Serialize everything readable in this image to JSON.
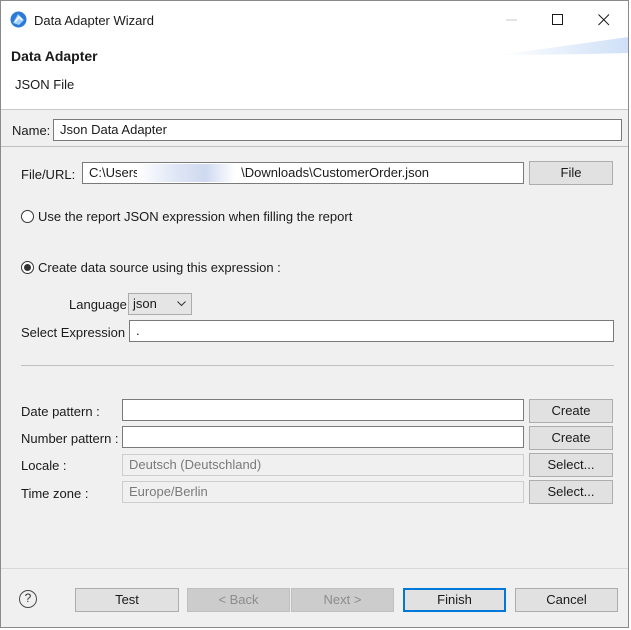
{
  "window": {
    "title": "Data Adapter Wizard"
  },
  "header": {
    "title": "Data Adapter",
    "subtitle": "JSON File"
  },
  "name": {
    "label": "Name:",
    "value": "Json Data Adapter"
  },
  "file": {
    "label": "File/URL:",
    "value_prefix": "C:\\Users\\",
    "value_suffix": "\\Downloads\\CustomerOrder.json",
    "button": "File"
  },
  "options": {
    "use_report": "Use the report JSON expression when filling the report",
    "create_ds": "Create data source using this expression :",
    "selected": "create_ds"
  },
  "language": {
    "label": "Language",
    "value": "json"
  },
  "select_expression": {
    "label": "Select Expression :",
    "value": "."
  },
  "date_pattern": {
    "label": "Date pattern :",
    "value": "",
    "button": "Create"
  },
  "number_pattern": {
    "label": "Number pattern :",
    "value": "",
    "button": "Create"
  },
  "locale": {
    "label": "Locale :",
    "value": "Deutsch (Deutschland)",
    "button": "Select..."
  },
  "timezone": {
    "label": "Time zone :",
    "value": "Europe/Berlin",
    "button": "Select..."
  },
  "footer": {
    "help": "?",
    "test": "Test",
    "back": "< Back",
    "next": "Next >",
    "finish": "Finish",
    "cancel": "Cancel"
  },
  "icons": {
    "app": "data-adapter-icon",
    "minimize": "minimize-icon",
    "maximize": "maximize-icon",
    "close": "close-icon"
  }
}
